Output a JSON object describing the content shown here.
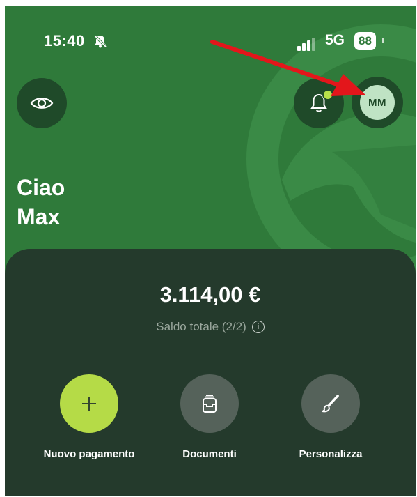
{
  "status_bar": {
    "time": "15:40",
    "network": "5G",
    "battery": "88",
    "icons": [
      "bell-muted-icon",
      "signal-icon"
    ]
  },
  "header": {
    "eye_icon": "eye-icon",
    "bell_icon": "bell-icon",
    "avatar_initials": "MM"
  },
  "greeting": {
    "line1": "Ciao",
    "line2": "Max"
  },
  "balance": {
    "amount": "3.114,00 €",
    "label": "Saldo totale (2/2)",
    "info_icon": "i"
  },
  "actions": [
    {
      "label": "Nuovo pagamento",
      "icon": "plus-icon"
    },
    {
      "label": "Documenti",
      "icon": "documents-icon"
    },
    {
      "label": "Personalizza",
      "icon": "paintbrush-icon"
    }
  ],
  "colors": {
    "background_green": "#2f7a3a",
    "dark_button": "#1f4a29",
    "panel": "#243a2c",
    "accent_lime": "#b5db47",
    "action_gray": "#55625a",
    "arrow_red": "#e3161b"
  }
}
